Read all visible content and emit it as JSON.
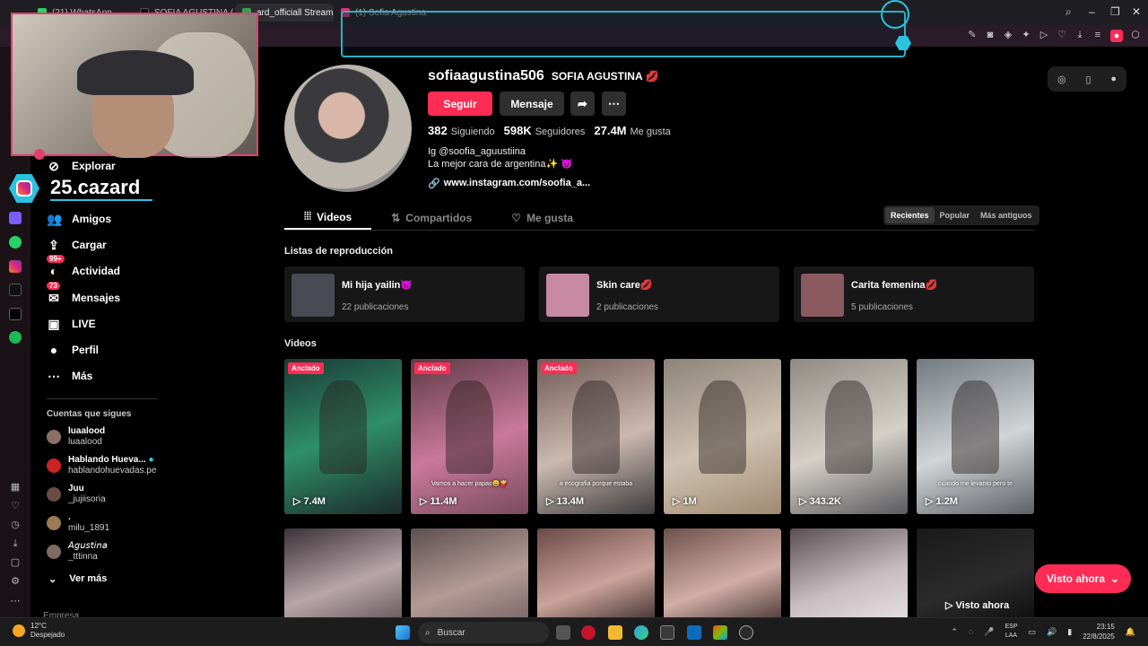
{
  "browser": {
    "tabs": [
      {
        "label": "(21) WhatsApp",
        "color": "#25d366"
      },
      {
        "label": "SOFIA AGUSTINA (@",
        "color": "#111"
      },
      {
        "label": "ard_officiall Stream",
        "color": "#2ea44f"
      },
      {
        "label": "(1) Sofia Agustina",
        "color": "#e1306c"
      }
    ],
    "tab_close": "×"
  },
  "overlay": {
    "username": "25.cazard"
  },
  "sidebar": {
    "nav": [
      {
        "icon": "⊘",
        "label": "Explorar",
        "name": "explore"
      },
      {
        "icon": "👥",
        "label": "Amigos",
        "name": "friends"
      },
      {
        "icon": "⇪",
        "label": "Cargar",
        "name": "upload"
      },
      {
        "icon": "◐",
        "label": "Actividad",
        "name": "activity",
        "badge": "99+"
      },
      {
        "icon": "✉",
        "label": "Mensajes",
        "name": "messages",
        "badge": "73"
      },
      {
        "icon": "▣",
        "label": "LIVE",
        "name": "live"
      },
      {
        "icon": "●",
        "label": "Perfil",
        "name": "profile"
      },
      {
        "icon": "⋯",
        "label": "Más",
        "name": "more"
      }
    ],
    "following_title": "Cuentas que sigues",
    "following": [
      {
        "name": "luaalood",
        "user": "luaalood"
      },
      {
        "name": "Hablando Huevа...",
        "user": "hablandohuevadas.pe",
        "verified": true
      },
      {
        "name": "Juu",
        "user": "_jujiisoria"
      },
      {
        "name": ".",
        "user": "milu_1891"
      },
      {
        "name": "𝘈𝘨𝘶𝘴𝘵𝘪𝘯𝘢",
        "user": "_tttinna"
      }
    ],
    "see_more": "Ver más",
    "company": "Empresa"
  },
  "profile": {
    "handle": "sofiaagustina506",
    "name": "SOFIA AGUSTINA 💋",
    "follow_btn": "Seguir",
    "message_btn": "Mensaje",
    "share_icon": "➦",
    "more_icon": "⋯",
    "following_count": "382",
    "following_label": "Siguiendo",
    "followers_count": "598K",
    "followers_label": "Seguidores",
    "likes_count": "27.4M",
    "likes_label": "Me gusta",
    "bio_line1": "Ig @soofia_aguustiina",
    "bio_line2": "La mejor cara de argentina✨ 😈",
    "link": "www.instagram.com/soofia_a..."
  },
  "tabs": [
    {
      "label": "Videos",
      "icon": "⦙⦙⦙",
      "active": true
    },
    {
      "label": "Compartidos",
      "icon": "⇅"
    },
    {
      "label": "Me gusta",
      "icon": "♡"
    }
  ],
  "sort": [
    "Recientes",
    "Popular",
    "Más antiguos"
  ],
  "playlists_title": "Listas de reproducción",
  "playlists": [
    {
      "title": "Mi hija yailin😈",
      "count": "22 publicaciones",
      "color": "#4a4a55"
    },
    {
      "title": "Skin care💋",
      "count": "2 publicaciones",
      "color": "#c78aa0"
    },
    {
      "title": "Carita femenina💋",
      "count": "5 publicaciones",
      "color": "#8a5a60"
    }
  ],
  "videos_title": "Videos",
  "pinned_label": "Anclado",
  "videos": [
    {
      "views": "▷ 7.4M",
      "pinned": true,
      "bg": "linear-gradient(160deg,#1b3a35,#2f8f6a 50%,#1c2a2a)",
      "caption": ""
    },
    {
      "views": "▷ 11.4M",
      "pinned": true,
      "bg": "linear-gradient(160deg,#5e3b46,#c9799a 55%,#7a4b5c)",
      "caption": "Vamos a hacer papas😄🍟"
    },
    {
      "views": "▷ 13.4M",
      "pinned": true,
      "bg": "linear-gradient(160deg,#6f5a55,#cbb8b0 55%,#3c3c3e)",
      "caption": "a ecografia porque estaba"
    },
    {
      "views": "▷ 1M",
      "pinned": false,
      "bg": "linear-gradient(160deg,#8d8379,#cfc2b2 55%,#a08a70)",
      "caption": ""
    },
    {
      "views": "▷ 343.2K",
      "pinned": false,
      "bg": "linear-gradient(160deg,#8f8a82,#d5cfc8 55%,#5a5a5e)",
      "caption": ""
    },
    {
      "views": "▷ 1.2M",
      "pinned": false,
      "bg": "linear-gradient(160deg,#707a80,#d1d4d6 55%,#5d6166)",
      "caption": "cuando me levanto pero te"
    }
  ],
  "videos_row2": [
    {
      "bg": "linear-gradient(160deg,#3c3237,#b8a5aa 60%,#6c5e62)"
    },
    {
      "bg": "linear-gradient(160deg,#5c5050,#b59a95 60%,#7c6a6a)"
    },
    {
      "bg": "linear-gradient(160deg,#6b4a46,#caa39a 60%,#4e3b3a)"
    },
    {
      "bg": "linear-gradient(160deg,#6e524c,#d0ada5 60%,#55423f)"
    },
    {
      "bg": "linear-gradient(160deg,#5a4f52,#c8bcc0 60%,#e4dedf)"
    },
    {
      "bg": "linear-gradient(160deg,#1a1a1a,#2b2b2b 60%,#111)"
    }
  ],
  "visto_inline": "▷ Visto ahora",
  "visto_button": "Visto ahora",
  "taskbar": {
    "temp": "12°C",
    "weather": "Despejado",
    "search": "Buscar",
    "lang1": "ESP",
    "lang2": "LAA",
    "time": "23:15",
    "date": "22/8/2025"
  }
}
